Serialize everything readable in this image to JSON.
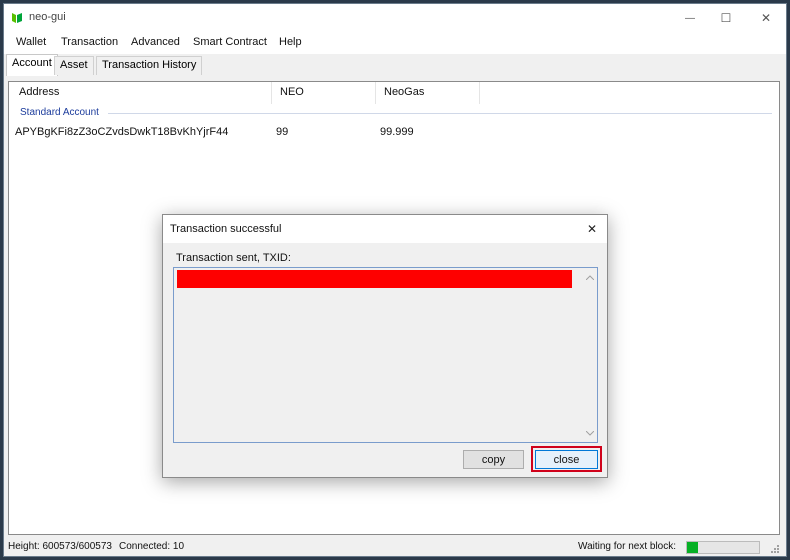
{
  "window": {
    "title": "neo-gui",
    "minimize_glyph": "—",
    "maximize_glyph": "☐",
    "close_glyph": "✕"
  },
  "menu": {
    "items": [
      "Wallet",
      "Transaction",
      "Advanced",
      "Smart Contract",
      "Help"
    ]
  },
  "tabs": [
    "Account",
    "Asset",
    "Transaction History"
  ],
  "accounts": {
    "columns": [
      "Address",
      "NEO",
      "NeoGas"
    ],
    "group": "Standard Account",
    "rows": [
      {
        "address": "APYBgKFi8zZ3oCZvdsDwkT18BvKhYjrF44",
        "neo": "99",
        "neogas": "99.999"
      }
    ]
  },
  "dialog": {
    "title": "Transaction successful",
    "label": "Transaction sent, TXID:",
    "copy_label": "copy",
    "close_label": "close",
    "close_glyph": "✕"
  },
  "status": {
    "height": "Height: 600573/600573",
    "connected": "Connected: 10",
    "waiting": "Waiting for next block:",
    "progress_fraction": 0.15
  },
  "colors": {
    "accent": "#06b025",
    "redaction": "#fe0000",
    "highlight": "#d0021b",
    "group_text": "#1c3c9c"
  },
  "icons": {
    "app": "neo-logo-icon",
    "scroll_up": "chevron-up-icon",
    "scroll_down": "chevron-down-icon",
    "grip": "resize-grip-icon"
  }
}
